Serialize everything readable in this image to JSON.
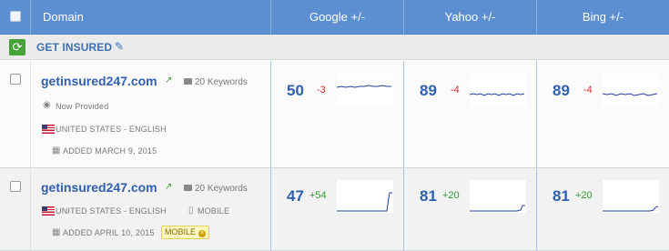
{
  "header": {
    "domain_label": "Domain",
    "google_label": "Google +/-",
    "yahoo_label": "Yahoo +/-",
    "bing_label": "Bing +/-"
  },
  "group": {
    "title": "GET INSURED"
  },
  "rows": [
    {
      "domain": "getinsured247.com",
      "keywords": "20 Keywords",
      "status": "Now Provided",
      "locale": "UNITED STATES - ENGLISH",
      "added": "ADDED MARCH 9, 2015",
      "google": {
        "rank": "50",
        "change": "-3"
      },
      "yahoo": {
        "rank": "89",
        "change": "-4"
      },
      "bing": {
        "rank": "89",
        "change": "-4"
      }
    },
    {
      "domain": "getinsured247.com",
      "keywords": "20 Keywords",
      "device": "MOBILE",
      "locale": "UNITED STATES - ENGLISH",
      "added": "ADDED APRIL 10, 2015",
      "badge": "MOBILE",
      "google": {
        "rank": "47",
        "change": "+54"
      },
      "yahoo": {
        "rank": "81",
        "change": "+20"
      },
      "bing": {
        "rank": "81",
        "change": "+20"
      }
    }
  ],
  "colors": {
    "header_bg": "#5b8fd2",
    "link": "#2f5fae",
    "negative": "#d02b2b",
    "positive": "#2e9a2e",
    "spark_line": "#1f3f9a"
  },
  "icons": {
    "refresh": "refresh-icon",
    "edit": "edit-icon",
    "external": "external-link-icon",
    "keywords": "keywords-icon",
    "flag": "us-flag-icon",
    "calendar": "calendar-icon",
    "mobile": "mobile-icon",
    "eye": "eye-icon"
  }
}
